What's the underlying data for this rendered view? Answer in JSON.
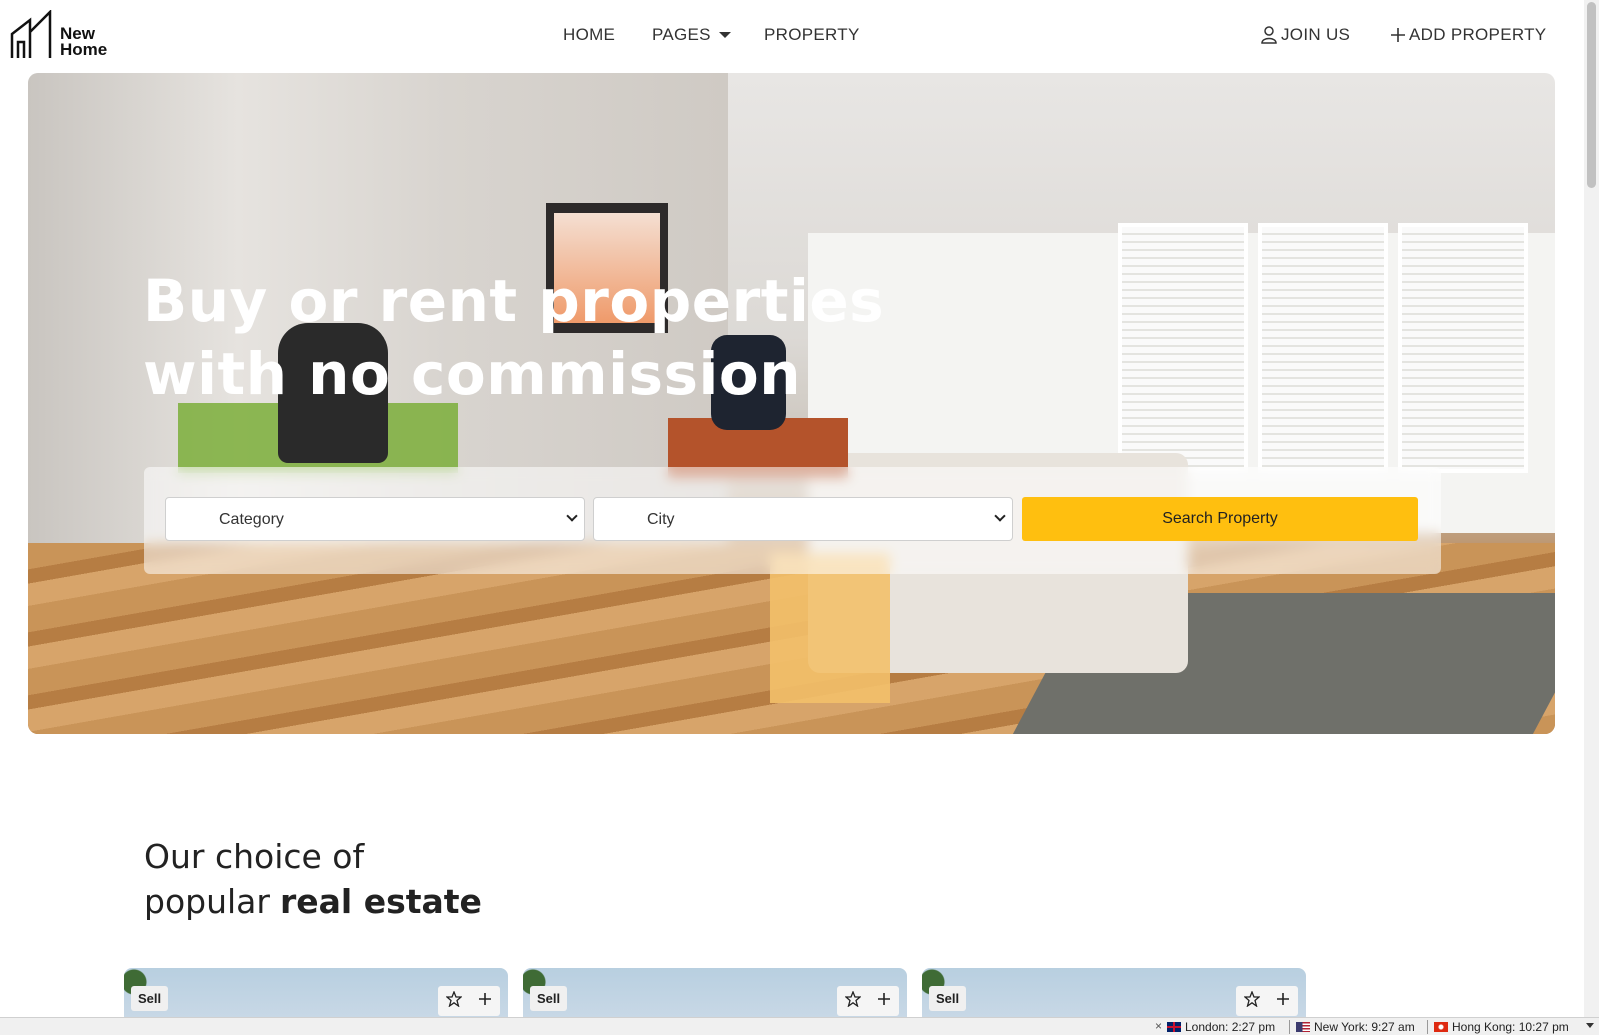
{
  "brand": {
    "line1": "New",
    "line2": "Home"
  },
  "nav": {
    "home": "HOME",
    "pages": "PAGES",
    "property": "PROPERTY",
    "join": "JOIN US",
    "add": "ADD PROPERTY"
  },
  "hero": {
    "title_line1": "Buy or rent properties",
    "title_line2": "with no commission"
  },
  "search": {
    "category": "Category",
    "city": "City",
    "button": "Search Property"
  },
  "section": {
    "line1": "Our choice of",
    "line2_regular": "popular",
    "line2_bold": "real estate"
  },
  "cards": [
    {
      "badge": "Sell"
    },
    {
      "badge": "Sell"
    },
    {
      "badge": "Sell"
    }
  ],
  "clocks": {
    "close": "×",
    "london": "London: 2:27 pm",
    "new_york": "New York: 9:27 am",
    "hong_kong": "Hong Kong: 10:27 pm"
  },
  "colors": {
    "accent": "#ffbf0f",
    "text": "#222222",
    "hero_text": "#ffffff"
  }
}
